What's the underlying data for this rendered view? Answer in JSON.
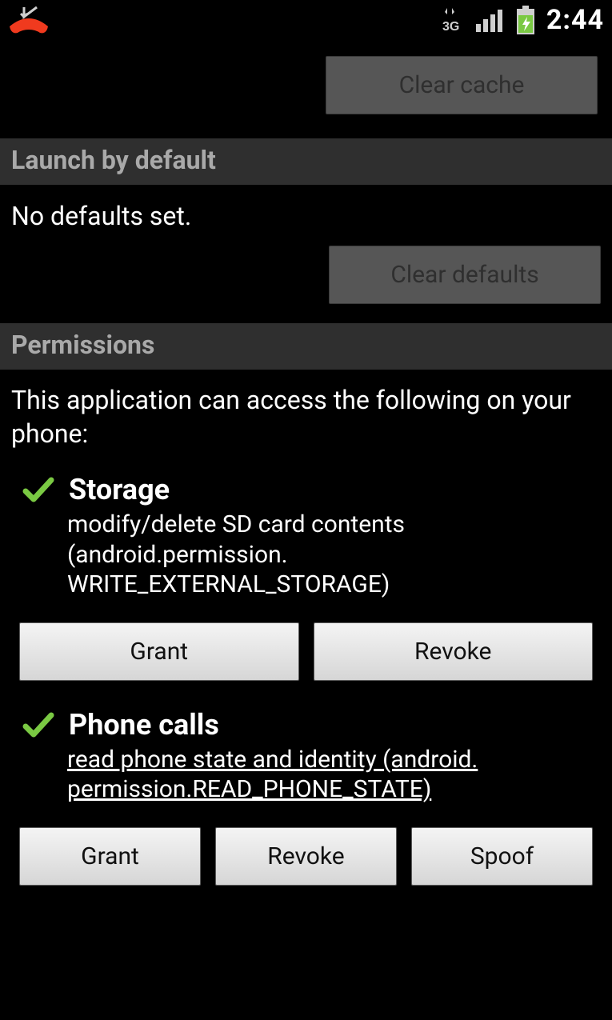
{
  "status_bar": {
    "clock": "2:44"
  },
  "cache": {
    "clear_cache_label": "Clear cache"
  },
  "launch": {
    "header": "Launch by default",
    "no_defaults": "No defaults set.",
    "clear_defaults_label": "Clear defaults"
  },
  "permissions": {
    "header": "Permissions",
    "description": "This application can access the following on your phone:",
    "groups": [
      {
        "title": "Storage",
        "detail": "modify/delete SD card contents (android.permission. WRITE_EXTERNAL_STORAGE)",
        "detail_underline": false,
        "buttons": [
          "Grant",
          "Revoke"
        ]
      },
      {
        "title": "Phone calls",
        "detail": "read phone state and identity (android. permission.READ_PHONE_STATE)",
        "detail_underline": true,
        "buttons": [
          "Grant",
          "Revoke",
          "Spoof"
        ]
      }
    ]
  }
}
